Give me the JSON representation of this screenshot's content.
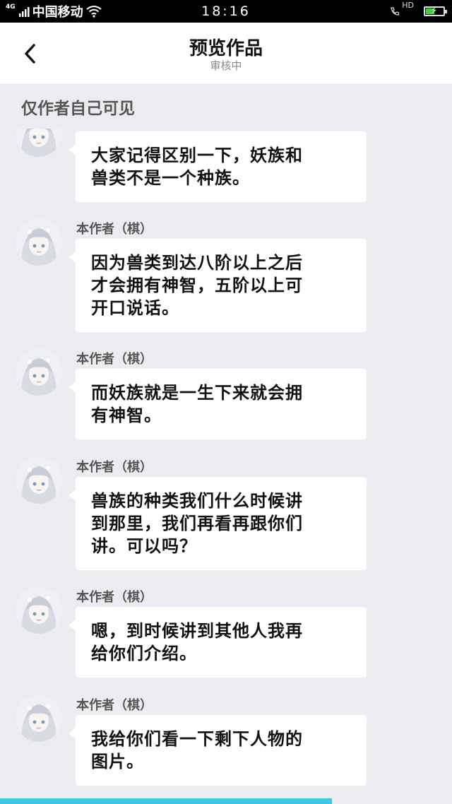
{
  "status_bar": {
    "network_type": "4G",
    "carrier": "中国移动",
    "time": "18:16",
    "hd_label": "HD",
    "battery_level": 0.55
  },
  "header": {
    "title": "预览作品",
    "subtitle": "审核中"
  },
  "notice": "仅作者自己可见",
  "messages": [
    {
      "author": "",
      "text_lines": [
        "大家记得区别一下，妖族和",
        "兽类不是一个种族。"
      ]
    },
    {
      "author": "本作者（棋）",
      "text_lines": [
        "因为兽类到达八阶以上之后",
        "才会拥有神智，五阶以上可",
        "开口说话。"
      ]
    },
    {
      "author": "本作者（棋）",
      "text_lines": [
        "而妖族就是一生下来就会拥",
        "有神智。"
      ]
    },
    {
      "author": "本作者（棋）",
      "text_lines": [
        "兽族的种类我们什么时候讲",
        "到那里，我们再看再跟你们",
        "讲。可以吗？"
      ]
    },
    {
      "author": "本作者（棋）",
      "text_lines": [
        "嗯，到时候讲到其他人我再",
        "给你们介绍。"
      ]
    },
    {
      "author": "本作者（棋）",
      "text_lines": [
        "我给你们看一下剩下人物的",
        "图片。"
      ]
    }
  ],
  "reading_progress": 0.734,
  "colors": {
    "accent": "#3ec7e0",
    "background": "#ebebf0",
    "bubble": "#ffffff",
    "battery": "#3ad13a"
  }
}
